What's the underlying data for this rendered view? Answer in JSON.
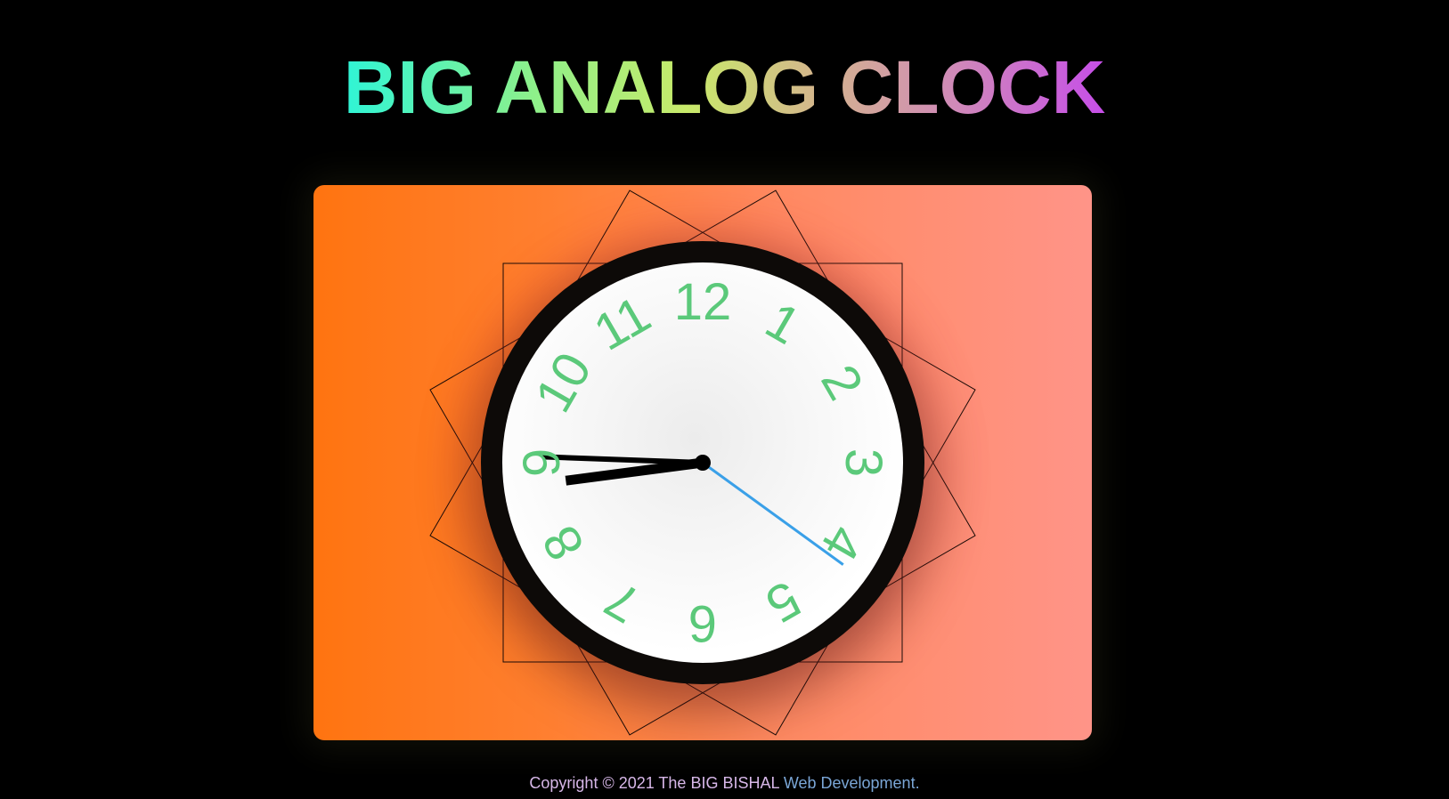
{
  "header": {
    "title": "BIG ANALOG CLOCK"
  },
  "clock": {
    "numerals": [
      "12",
      "1",
      "2",
      "3",
      "4",
      "5",
      "6",
      "7",
      "8",
      "9",
      "10",
      "11"
    ],
    "time": {
      "hour": 8,
      "minute": 45,
      "second": 21
    },
    "numeral_color": "#5bc97a",
    "second_hand_color": "#3aa0e8",
    "panel_gradient": [
      "#ff7410",
      "#ff9488"
    ]
  },
  "footer": {
    "copyright_prefix": "Copyright © 2021 The BIG BISHAL",
    "copyright_suffix": "Web Development."
  }
}
